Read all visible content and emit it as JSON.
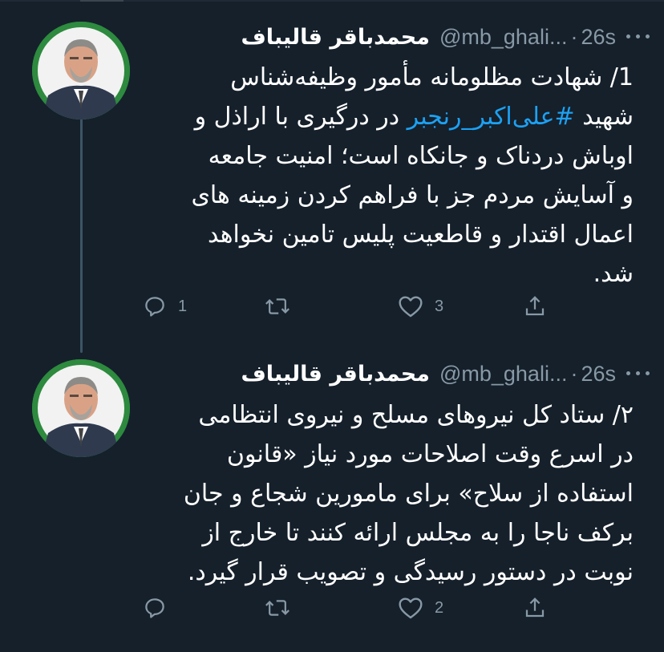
{
  "tweets": [
    {
      "display_name": "محمدباقر قالیباف",
      "handle": "@mb_ghali...",
      "separator": "·",
      "time": "26s",
      "lines": [
        "1/ شهادت مظلومانه مأمور وظیفه‌شناس",
        "",
        "اوباش دردناک و جانکاه است؛ امنیت جامعه",
        "و آسایش مردم جز با فراهم کردن زمینه های",
        "اعمال اقتدار و قاطعیت پلیس تامین نخواهد",
        "شد."
      ],
      "line2_prefix": "شهید ",
      "hashtag": "#علی‌اکبر_رنجبر",
      "line2_suffix": " در درگیری با اراذل و",
      "reply_count": "1",
      "retweet_count": "",
      "like_count": "3",
      "icons": {
        "reply": "reply-icon",
        "retweet": "retweet-icon",
        "like": "heart-icon",
        "share": "share-icon",
        "more": "more-icon"
      }
    },
    {
      "display_name": "محمدباقر قالیباف",
      "handle": "@mb_ghali...",
      "separator": "·",
      "time": "26s",
      "lines": [
        "۲/ ستاد کل نیروهای مسلح و نیروی انتظامی",
        "در اسرع وقت اصلاحات مورد نیاز «قانون",
        "استفاده از سلاح» برای مامورین شجاع و جان",
        "برکف ناجا را به مجلس ارائه کنند تا خارج از",
        "نوبت در دستور رسیدگی و تصویب قرار گیرد."
      ],
      "reply_count": "",
      "retweet_count": "",
      "like_count": "2",
      "icons": {
        "reply": "reply-icon",
        "retweet": "retweet-icon",
        "like": "heart-icon",
        "share": "share-icon",
        "more": "more-icon"
      }
    }
  ],
  "colors": {
    "background": "#15202b",
    "text": "#ffffff",
    "secondary": "#8899a6",
    "link": "#1da1f2",
    "thread_line": "#3d5466",
    "avatar_bg": "#2d8a3e"
  }
}
